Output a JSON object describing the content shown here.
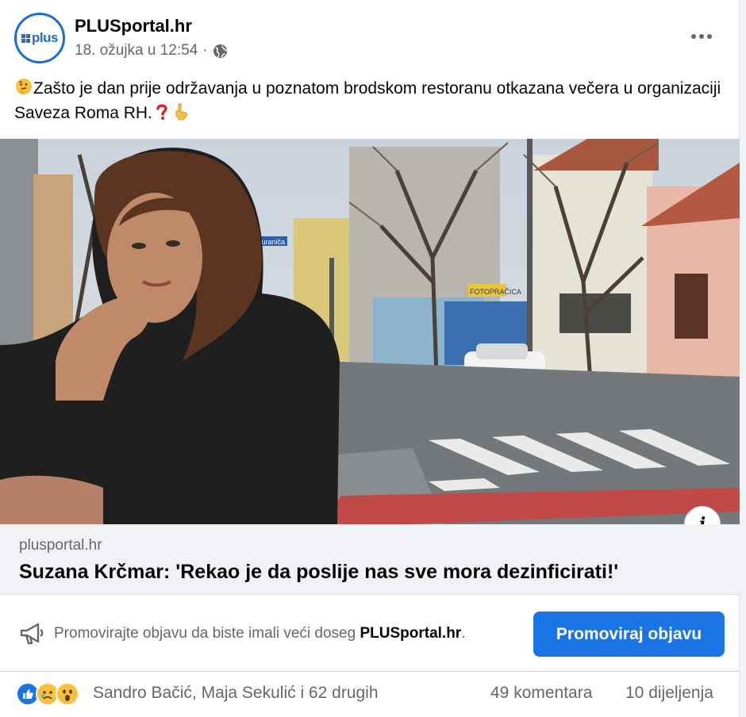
{
  "post": {
    "page_name": "PLUSportal.hr",
    "avatar_text": "plus",
    "timestamp": "18. ožujka u 12:54",
    "separator": "·",
    "privacy_icon": "globe-icon",
    "body_emoji_start": "thinking-face-icon",
    "body": "Zašto je dan prije održavanja u poznatom brodskom restoranu otkazana večera u organizaciji Saveza Roma RH.",
    "body_emoji_end": [
      "red-question-mark-icon",
      "pointing-down-icon"
    ]
  },
  "link": {
    "domain": "plusportal.hr",
    "title": "Suzana Krčmar: 'Rekao je da poslije nas sve mora dezinficirati!'",
    "info_label": "i",
    "image_signs": [
      "Žuraniča",
      "FOTOPRAČICA"
    ]
  },
  "promote": {
    "text_before": "Promovirajte objavu da biste imali veći doseg ",
    "text_page": "PLUSportal.hr",
    "text_after": ".",
    "button_label": "Promoviraj objavu"
  },
  "reactions": {
    "icons": [
      "like-icon",
      "sad-icon",
      "wow-icon"
    ],
    "names": "Sandro Bačić, Maja Sekulić i 62 drugih",
    "comments": "49 komentara",
    "shares": "10 dijeljenja"
  },
  "colors": {
    "accent": "#1b74e4",
    "brand": "#1a6fd4",
    "secondary_text": "#65676b",
    "link_bg": "#f0f2f5"
  }
}
